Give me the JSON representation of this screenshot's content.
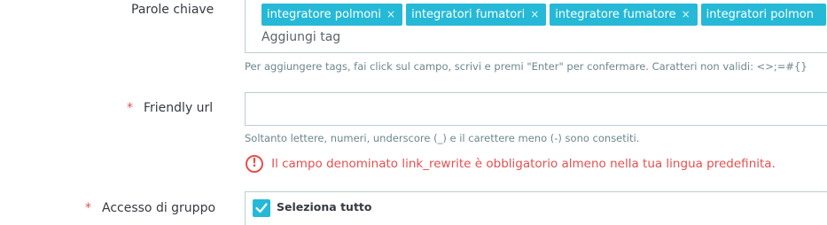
{
  "keywords": {
    "label": "Parole chiave",
    "tags": [
      {
        "text": "integratore polmoni",
        "remove": "×"
      },
      {
        "text": "integratori fumatori",
        "remove": "×"
      },
      {
        "text": "integratore fumatore",
        "remove": "×"
      },
      {
        "text": "integratori polmon",
        "remove": ""
      }
    ],
    "add_placeholder": "Aggiungi tag",
    "help": "Per aggiungere tags, fai click sul campo, scrivi e premi \"Enter\" per confermare. Caratteri non validi: <>;=#{}"
  },
  "friendly_url": {
    "required_mark": "*",
    "label": "Friendly url",
    "value": "",
    "help": "Soltanto lettere, numeri, underscore (_) e il carettere meno (-) sono consetiti.",
    "error_icon": "!",
    "error": "Il campo denominato link_rewrite è obbligatorio almeno nella tua lingua predefinita."
  },
  "group_access": {
    "required_mark": "*",
    "label": "Accesso di gruppo",
    "select_all": "Seleziona tutto",
    "select_all_checked": true
  },
  "colors": {
    "accent": "#25b9d7",
    "error": "#e84e4e",
    "border": "#bbcdd2",
    "help_text": "#6c868e"
  }
}
